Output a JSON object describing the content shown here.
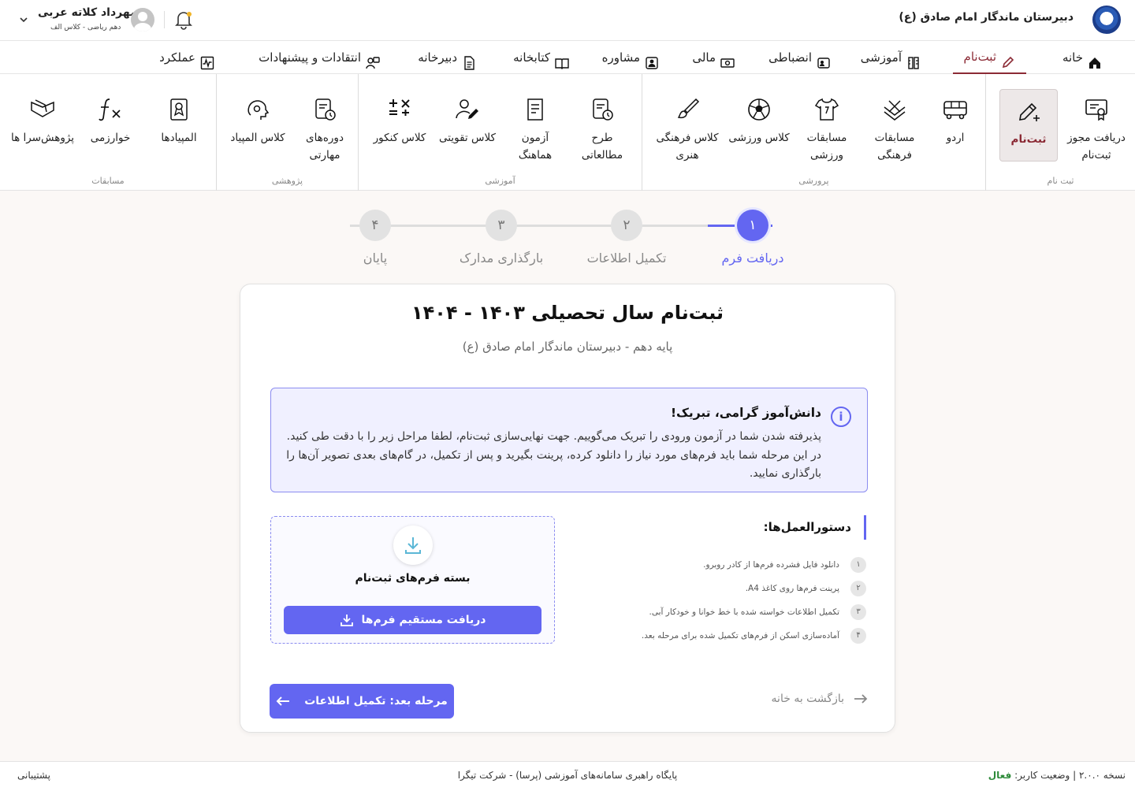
{
  "header": {
    "school_name": "دبیرستان ماندگار امام صادق (ع)",
    "user_name": "مهرداد کلاته عربی",
    "user_class": "دهم ریاضی - کلاس الف"
  },
  "nav": {
    "home": "خانه",
    "register": "ثبت‌نام",
    "education": "آموزشی",
    "discipline": "انضباطی",
    "finance": "مالی",
    "counseling": "مشاوره",
    "library": "کتابخانه",
    "secretariat": "دبیرخانه",
    "feedback": "انتقادات و پیشنهادات",
    "performance": "عملکرد"
  },
  "ribbon": {
    "groups": {
      "registration": "ثبت نام",
      "cultivation": "پرورشی",
      "educational": "آموزشی",
      "research": "پژوهشی",
      "competitions": "مسابقات"
    },
    "items": {
      "permit_1": "دریافت مجوز",
      "permit_2": "ثبت‌نام",
      "register": "ثبت‌نام",
      "camp": "اردو",
      "cultural_1": "مسابقات",
      "cultural_2": "فرهنگی",
      "sports_comp_1": "مسابقات",
      "sports_comp_2": "ورزشی",
      "sports_class": "کلاس ورزشی",
      "art_class_1": "کلاس فرهنگی",
      "art_class_2": "هنری",
      "study_plan_1": "طرح",
      "study_plan_2": "مطالعاتی",
      "uniform_exam_1": "آزمون",
      "uniform_exam_2": "هماهنگ",
      "tutoring": "کلاس تقویتی",
      "konkur": "کلاس کنکور",
      "skill_1": "دوره‌های",
      "skill_2": "مهارتی",
      "olympiad_class": "کلاس المپیاد",
      "olympiads": "المپیادها",
      "kharazmi": "خوارزمی",
      "research_houses": "پژوهش‌سرا ها"
    }
  },
  "stepper": {
    "steps": [
      {
        "num": "۱",
        "label": "دریافت فرم"
      },
      {
        "num": "۲",
        "label": "تکمیل اطلاعات"
      },
      {
        "num": "۳",
        "label": "بارگذاری مدارک"
      },
      {
        "num": "۴",
        "label": "پایان"
      }
    ]
  },
  "card": {
    "title": "ثبت‌نام سال تحصیلی ۱۴۰۳ - ۱۴۰۴",
    "subtitle": "پایه دهم - دبیرستان ماندگار امام صادق (ع)",
    "alert_title": "دانش‌آموز گرامی، تبریک!",
    "alert_body": "پذیرفته شدن شما در آزمون ورودی را تبریک می‌گوییم. جهت نهایی‌سازی ثبت‌نام، لطفا مراحل زیر را با دقت طی کنید. در این مرحله شما باید فرم‌های مورد نیاز را دانلود کرده، پرینت بگیرید و پس از تکمیل، در گام‌های بعدی تصویر آن‌ها را بارگذاری نمایید.",
    "download_title": "بسته فرم‌های ثبت‌نام",
    "download_button": "دریافت مستقیم فرم‌ها",
    "rules_title": "دستورالعمل‌ها:",
    "rules": [
      {
        "num": "۱",
        "text": "دانلود فایل فشرده فرم‌ها از کادر روبرو."
      },
      {
        "num": "۲",
        "text": "پرینت فرم‌ها روی کاغذ A4."
      },
      {
        "num": "۳",
        "text": "تکمیل اطلاعات خواسته شده با خط خوانا و خودکار آبی."
      },
      {
        "num": "۴",
        "text": "آماده‌سازی اسکن از فرم‌های تکمیل شده برای مرحله بعد."
      }
    ],
    "back_link": "بازگشت به خانه",
    "next_button": "مرحله بعد: تکمیل اطلاعات"
  },
  "footer": {
    "version": "نسخه ۲.۰.۰ | وضعیت کاربر:",
    "status": "فعال",
    "center": "پایگاه راهبری سامانه‌های آموزشی (پرسا) - شرکت تیگرا",
    "support": "پشتیبانی"
  },
  "colors": {
    "accent": "#6366f1",
    "active_nav": "#8b2a35",
    "status_active": "#2e8b3a"
  }
}
